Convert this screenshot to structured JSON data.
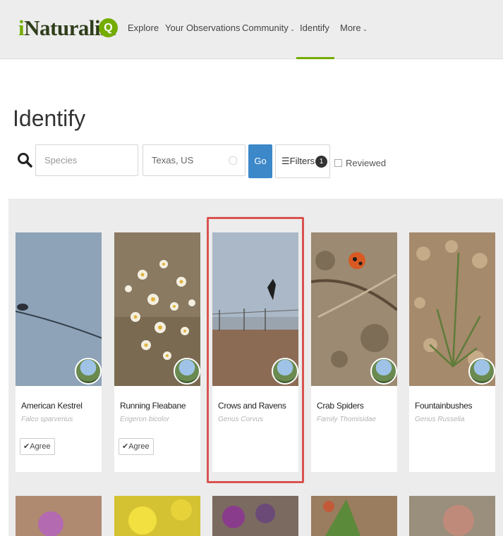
{
  "header": {
    "logo_prefix": "i",
    "logo_rest": "Naturalist",
    "search_glyph": "Q",
    "nav": [
      {
        "label": "Explore",
        "caret": false
      },
      {
        "label": "Your Observations",
        "caret": false
      },
      {
        "label": "Community",
        "caret": true
      },
      {
        "label": "Identify",
        "caret": false,
        "active": true
      },
      {
        "label": "More",
        "caret": true
      }
    ]
  },
  "identify": {
    "title": "Identify",
    "species_placeholder": "Species",
    "place_value": "Texas, US",
    "go_label": "Go",
    "filters_label": "Filters",
    "filters_count": "1",
    "reviewed_label": "Reviewed"
  },
  "cards": [
    {
      "name": "American Kestrel",
      "scientific": "Falco sparverius",
      "agree": "Agree",
      "image": "sky-wire"
    },
    {
      "name": "Running Fleabane",
      "scientific": "Erigeron bicolor",
      "agree": "Agree",
      "image": "daisies"
    },
    {
      "name": "Crows and Ravens",
      "scientific": "Genus Corvus",
      "agree": "",
      "image": "bird-flight",
      "highlighted": true
    },
    {
      "name": "Crab Spiders",
      "scientific": "Family Thomisidae",
      "agree": "",
      "image": "spider"
    },
    {
      "name": "Fountainbushes",
      "scientific": "Genus Russelia",
      "agree": "",
      "image": "plant"
    }
  ],
  "colors": {
    "brand_green": "#74ac00",
    "go_blue": "#3c88c9",
    "highlight_red": "#d9534f"
  }
}
